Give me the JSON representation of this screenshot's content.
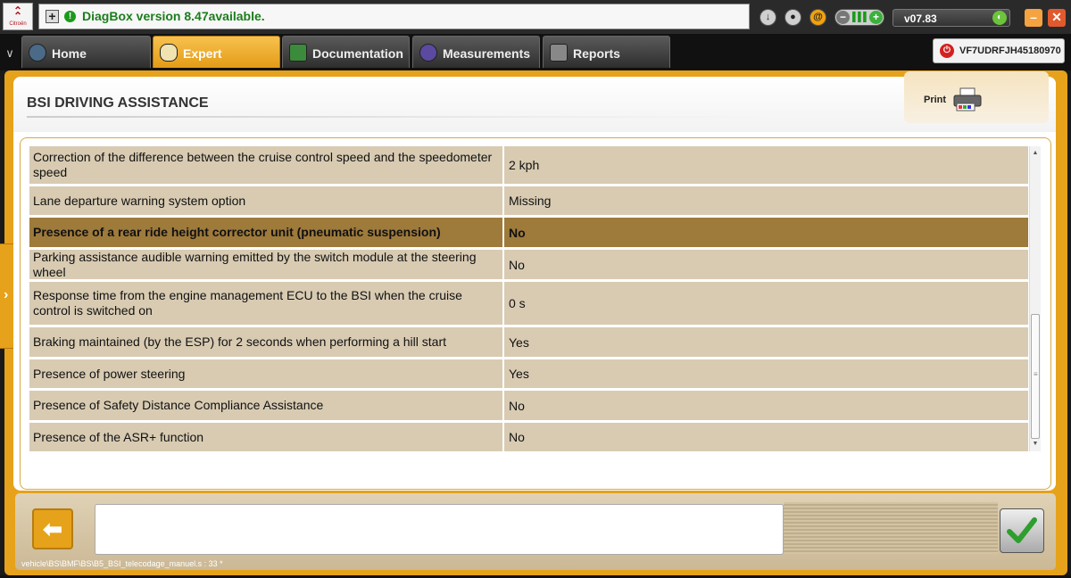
{
  "app": {
    "notice_text": "DiagBox version 8.47available.",
    "version": "v07.83",
    "vin": "VF7UDRFJH45180970",
    "brand_text": "Citroën"
  },
  "tabs": [
    {
      "label": "Home",
      "active": false
    },
    {
      "label": "Expert",
      "active": true
    },
    {
      "label": "Documentation",
      "active": false
    },
    {
      "label": "Measurements",
      "active": false
    },
    {
      "label": "Reports",
      "active": false
    }
  ],
  "page": {
    "title": "BSI  DRIVING ASSISTANCE",
    "print_label": "Print"
  },
  "rows": [
    {
      "param": "Correction of the difference between the cruise control speed and the speedometer speed",
      "value": "2 kph"
    },
    {
      "param": "Lane departure warning system option",
      "value": "Missing"
    },
    {
      "param": "Presence of a rear ride height corrector unit (pneumatic suspension)",
      "value": "No",
      "selected": true
    },
    {
      "param": "Parking assistance audible warning emitted by the switch module at the steering wheel",
      "value": "No"
    },
    {
      "param": "Response time from the engine management ECU to the BSI when the cruise control is switched on",
      "value": "0 s"
    },
    {
      "param": "Braking maintained (by the ESP) for 2 seconds when performing a hill start",
      "value": "Yes"
    },
    {
      "param": "Presence of power steering",
      "value": "Yes"
    },
    {
      "param": "Presence of Safety Distance Compliance Assistance",
      "value": "No"
    },
    {
      "param": "Presence of the ASR+ function",
      "value": "No"
    }
  ],
  "footer": {
    "script_path": "vehicle\\BS\\BMF\\BS\\B5_BSI_telecodage_manuel.s : 33 *"
  },
  "colors": {
    "accent": "#e6a21a",
    "row_bg": "#d8cbb2",
    "row_selected": "#9e7a3b",
    "notice_green": "#1b7d1b"
  }
}
